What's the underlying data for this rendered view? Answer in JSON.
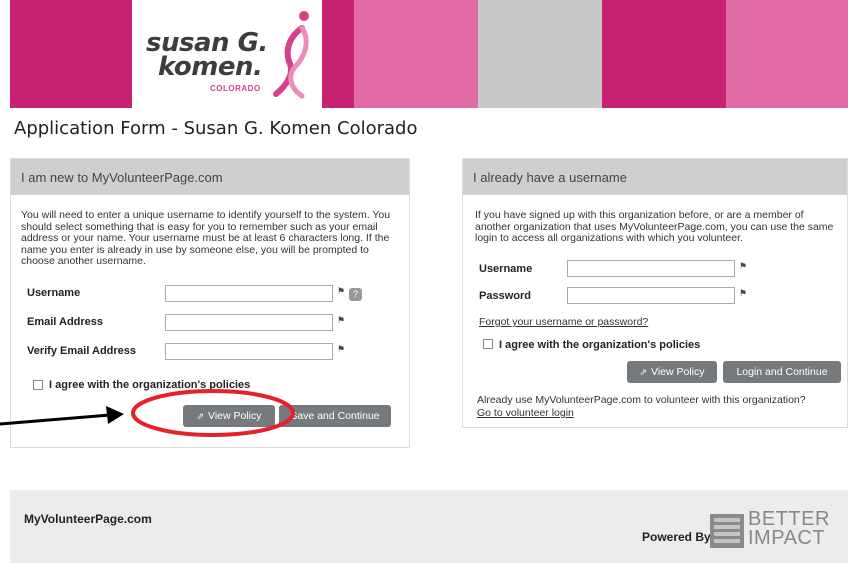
{
  "header": {
    "logo_line1": "susan G.",
    "logo_line2": "komen.",
    "logo_region": "COLORADO",
    "banner_colors": [
      "#c82373",
      "#ffffff",
      "#c82373",
      "#e06aa3",
      "#c8c8c8",
      "#c82373",
      "#e06aa3"
    ]
  },
  "page_title": "Application Form - Susan G. Komen Colorado",
  "new_user": {
    "heading": "I am new to MyVolunteerPage.com",
    "intro": "You will need to enter a unique username to identify yourself to the system. You should select something that is easy for you to remember such as your email address or your name. Your username must be at least 6 characters long. If the name you enter is already in use by someone else, you will be prompted to choose another username.",
    "fields": [
      {
        "label": "Username",
        "value": ""
      },
      {
        "label": "Email Address",
        "value": ""
      },
      {
        "label": "Verify Email Address",
        "value": ""
      }
    ],
    "agree_label": "I agree with the organization's policies",
    "view_policy": "View Policy",
    "save_continue": "Save and Continue"
  },
  "existing_user": {
    "heading": "I already have a username",
    "intro": "If you have signed up with this organization before, or are a member of another organization that uses MyVolunteerPage.com, you can use the same login to access all organizations with which you volunteer.",
    "fields": [
      {
        "label": "Username",
        "value": ""
      },
      {
        "label": "Password",
        "value": ""
      }
    ],
    "forgot_link": "Forgot your username or password?",
    "agree_label": "I agree with the organization's policies",
    "view_policy": "View Policy",
    "login_continue": "Login and Continue",
    "already_text": "Already use MyVolunteerPage.com to volunteer with this organization?",
    "volunteer_login_link": "Go to volunteer login"
  },
  "footer": {
    "site": "MyVolunteerPage.com",
    "powered_by": "Powered By",
    "brand_line1": "BETTER",
    "brand_line2": "IMPACT"
  },
  "annotation": {
    "arrow_color": "#000000",
    "circle_color": "#e8202a"
  }
}
